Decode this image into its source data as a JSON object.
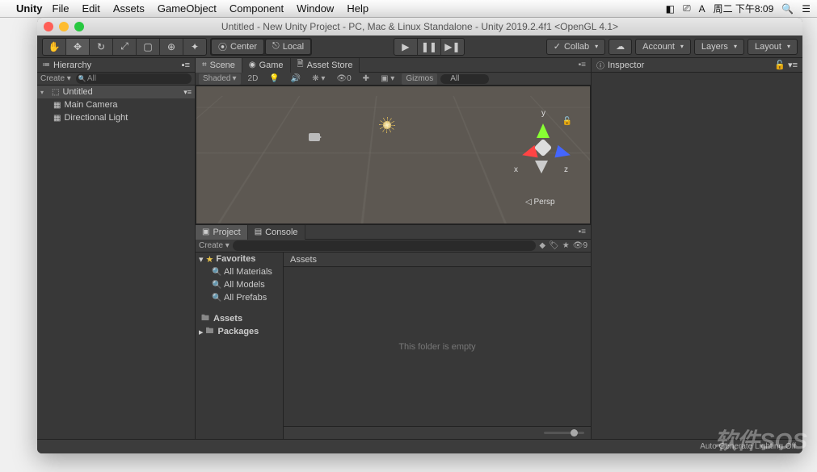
{
  "menubar": {
    "app": "Unity",
    "items": [
      "File",
      "Edit",
      "Assets",
      "GameObject",
      "Component",
      "Window",
      "Help"
    ],
    "clock": "周二 下午8:09"
  },
  "window": {
    "title": "Untitled - New Unity Project - PC, Mac & Linux Standalone - Unity 2019.2.4f1 <OpenGL 4.1>"
  },
  "toolbar": {
    "center": "Center",
    "local": "Local",
    "collab": "Collab",
    "account": "Account",
    "layers": "Layers",
    "layout": "Layout"
  },
  "hierarchy": {
    "title": "Hierarchy",
    "create": "Create",
    "search_all": "All",
    "scene": "Untitled",
    "items": [
      "Main Camera",
      "Directional Light"
    ]
  },
  "sceneTabs": {
    "scene": "Scene",
    "game": "Game",
    "assetstore": "Asset Store"
  },
  "sceneCtl": {
    "shading": "Shaded",
    "mode2d": "2D",
    "gizmos": "Gizmos",
    "all": "All"
  },
  "gizmo": {
    "x": "x",
    "y": "y",
    "z": "z",
    "persp": "Persp"
  },
  "inspector": {
    "title": "Inspector"
  },
  "project": {
    "tab_project": "Project",
    "tab_console": "Console",
    "create": "Create",
    "hidden_count": "9",
    "favorites": "Favorites",
    "fav_items": [
      "All Materials",
      "All Models",
      "All Prefabs"
    ],
    "assets": "Assets",
    "packages": "Packages",
    "assets_header": "Assets",
    "empty": "This folder is empty"
  },
  "status": {
    "lighting": "Auto Generate Lighting Off"
  },
  "watermark": "软件SOS"
}
